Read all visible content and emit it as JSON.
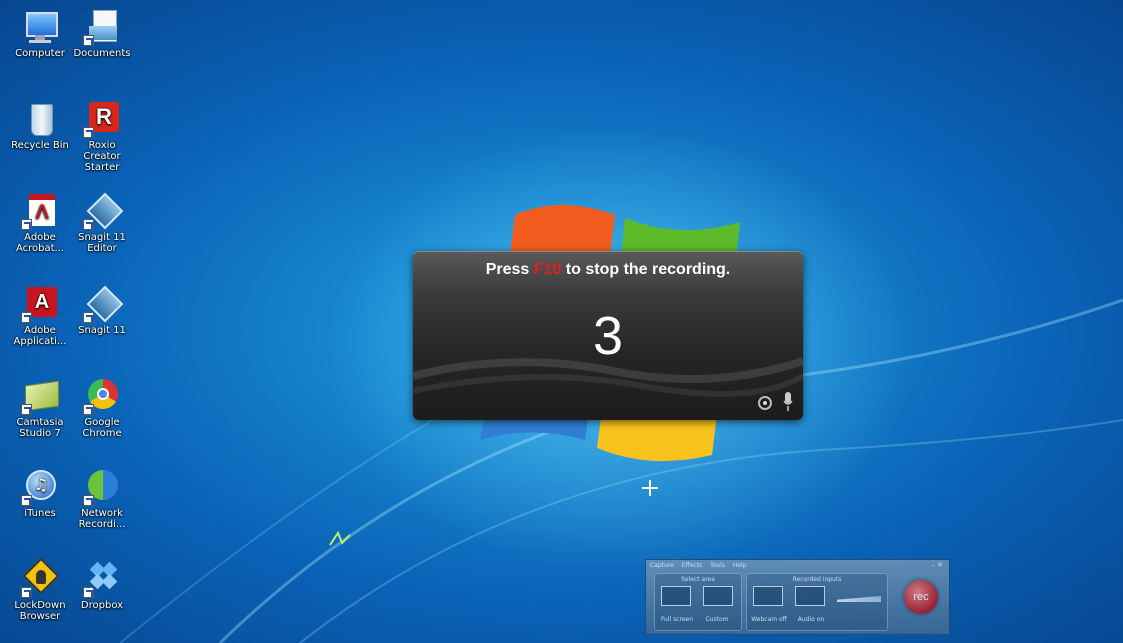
{
  "desktop": {
    "icons": [
      {
        "label": "Computer",
        "icon": "computer-icon"
      },
      {
        "label": "Documents",
        "icon": "documents-icon"
      },
      {
        "label": "Recycle Bin",
        "icon": "recycle-bin-icon"
      },
      {
        "label": "Roxio Creator Starter",
        "icon": "roxio-icon"
      },
      {
        "label": "Adobe Acrobat...",
        "icon": "acrobat-icon"
      },
      {
        "label": "Snagit 11 Editor",
        "icon": "snagit-editor-icon"
      },
      {
        "label": "Adobe Applicati...",
        "icon": "adobe-app-icon"
      },
      {
        "label": "Snagit 11",
        "icon": "snagit-icon"
      },
      {
        "label": "Camtasia Studio 7",
        "icon": "camtasia-icon"
      },
      {
        "label": "Google Chrome",
        "icon": "chrome-icon"
      },
      {
        "label": "iTunes",
        "icon": "itunes-icon"
      },
      {
        "label": "Network Recordi...",
        "icon": "network-recorder-icon"
      },
      {
        "label": "LockDown Browser",
        "icon": "lockdown-icon"
      },
      {
        "label": "Dropbox",
        "icon": "dropbox-icon"
      }
    ]
  },
  "recording_overlay": {
    "message_before": "Press ",
    "key": "F10",
    "message_after": " to stop the recording.",
    "countdown": "3",
    "colors": {
      "key": "#e2201a"
    }
  },
  "recorder": {
    "menu": [
      "Capture",
      "Effects",
      "Tools",
      "Help"
    ],
    "window_buttons": "– ✕",
    "select_area_title": "Select area",
    "full_screen": "Full screen",
    "custom": "Custom",
    "recorded_inputs_title": "Recorded inputs",
    "webcam": "Webcam off",
    "audio": "Audio on",
    "rec": "rec"
  }
}
